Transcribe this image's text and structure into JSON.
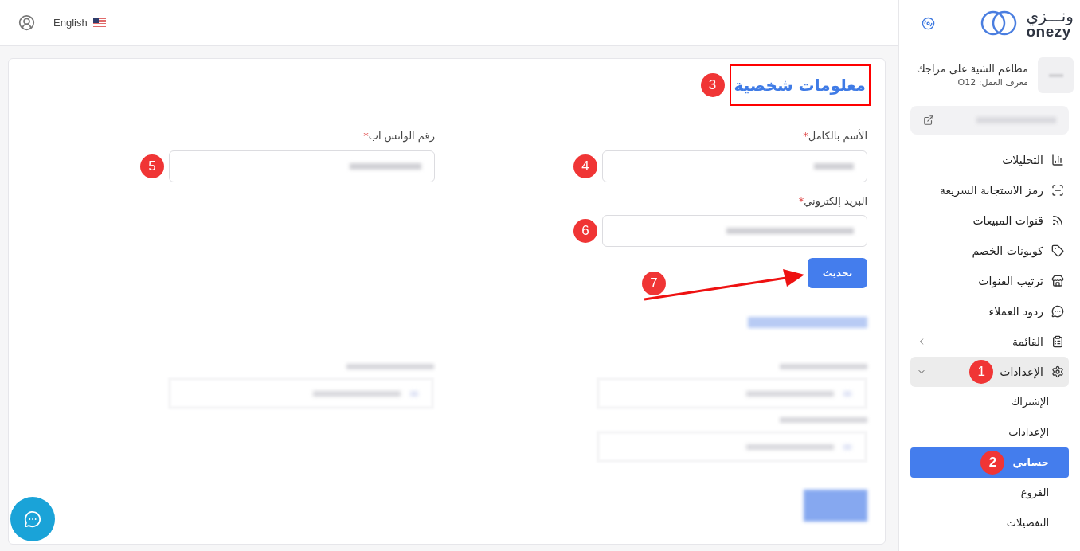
{
  "topbar": {
    "language": "English"
  },
  "sidebar": {
    "logo": {
      "arabic": "ونـــزي",
      "latin": "onezy"
    },
    "business": {
      "name": "مطاعم الشية على مزاجك",
      "id_label": "معرف العمل: O12"
    },
    "nav": [
      {
        "label": "التحليلات"
      },
      {
        "label": "رمز الاستجابة السريعة"
      },
      {
        "label": "قنوات المبيعات"
      },
      {
        "label": "كوبونات الخصم"
      },
      {
        "label": "ترتيب القنوات"
      },
      {
        "label": "ردود العملاء"
      },
      {
        "label": "القائمة",
        "expanded": false
      },
      {
        "label": "الإعدادات",
        "expanded": true,
        "annotation": "1",
        "children": [
          {
            "label": "الإشتراك",
            "selected": false
          },
          {
            "label": "الإعدادات",
            "selected": false
          },
          {
            "label": "حسابي",
            "selected": true,
            "annotation": "2"
          },
          {
            "label": "الفروع",
            "selected": false
          },
          {
            "label": "التفضيلات",
            "selected": false
          }
        ]
      }
    ]
  },
  "form": {
    "title": "معلومات شخصية",
    "title_annotation": "3",
    "fields": [
      {
        "label": "الأسم بالكامل",
        "required_mark": "*",
        "annotation": "4"
      },
      {
        "label": "رقم الواتس اب",
        "required_mark": "*",
        "annotation": "5"
      },
      {
        "label": "البريد إلكتروني",
        "required_mark": "*",
        "annotation": "6"
      }
    ],
    "submit": {
      "label": "تحديث",
      "annotation": "7"
    }
  }
}
